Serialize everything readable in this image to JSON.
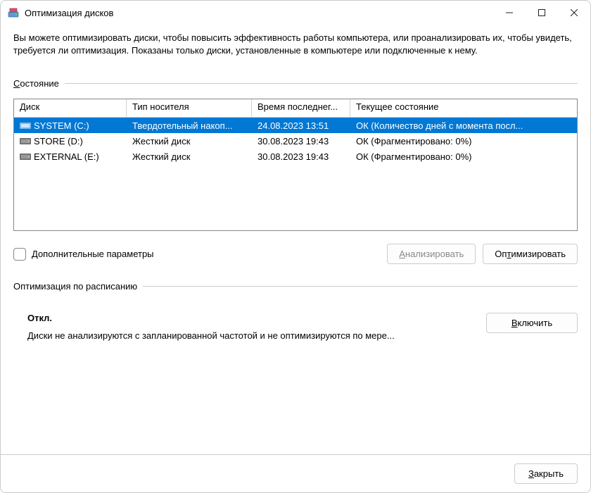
{
  "window": {
    "title": "Оптимизация дисков",
    "description": "Вы можете оптимизировать диски, чтобы повысить эффективность работы  компьютера, или проанализировать их, чтобы увидеть, требуется ли оптимизация. Показаны только диски, установленные в компьютере или подключенные к нему."
  },
  "status_section": {
    "label_prefix": "С",
    "label_rest": "остояние"
  },
  "table": {
    "headers": {
      "disk": "Диск",
      "media": "Тип носителя",
      "lastrun": "Время последнег...",
      "status": "Текущее состояние"
    },
    "rows": [
      {
        "name": "SYSTEM (C:)",
        "media": "Твердотельный накоп...",
        "lastrun": "24.08.2023 13:51",
        "status": "ОК (Количество дней с момента посл...",
        "selected": true,
        "icon": "ssd"
      },
      {
        "name": "STORE (D:)",
        "media": "Жесткий диск",
        "lastrun": "30.08.2023 19:43",
        "status": "ОК (Фрагментировано: 0%)",
        "selected": false,
        "icon": "hdd"
      },
      {
        "name": "EXTERNAL (E:)",
        "media": "Жесткий диск",
        "lastrun": "30.08.2023 19:43",
        "status": "ОК (Фрагментировано: 0%)",
        "selected": false,
        "icon": "hdd"
      }
    ]
  },
  "advanced": {
    "label_prefix": "Д",
    "label_rest": "ополнительные параметры"
  },
  "buttons": {
    "analyze_prefix": "А",
    "analyze_rest": "нализировать",
    "optimize_prefix": "Оп",
    "optimize_underline": "т",
    "optimize_rest": "имизировать",
    "enable_prefix": "В",
    "enable_rest": "ключить",
    "close_prefix": "З",
    "close_rest": "акрыть"
  },
  "schedule": {
    "title": "Оптимизация по расписанию",
    "status": "Откл.",
    "desc": "Диски не анализируются с запланированной частотой и не оптимизируются по мере..."
  }
}
